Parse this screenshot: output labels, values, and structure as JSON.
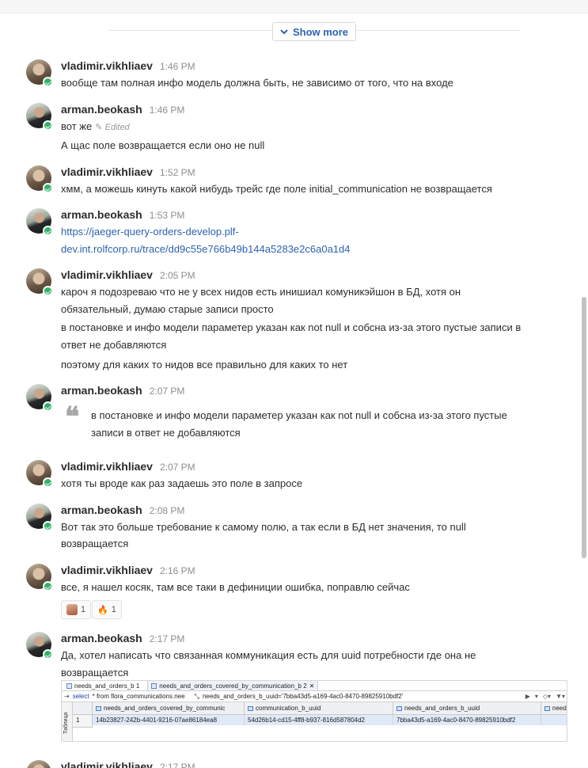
{
  "show_more": {
    "label": "Show more"
  },
  "messages": [
    {
      "author": "vladimir.vikhliaev",
      "time": "1:46 PM",
      "lines": [
        "вообще там полная инфо модель должна быть, не зависимо от того, что на входе"
      ]
    },
    {
      "author": "arman.beokash",
      "time": "1:46 PM",
      "lines": [
        "вот же",
        "А щас поле возвращается если оно не null"
      ],
      "edited": "Edited"
    },
    {
      "author": "vladimir.vikhliaev",
      "time": "1:52 PM",
      "lines": [
        "хмм, а можешь кинуть какой нибудь трейс где поле initial_communication не возвращается"
      ]
    },
    {
      "author": "arman.beokash",
      "time": "1:53 PM",
      "link_lines": [
        "https://jaeger-query-orders-develop.plf-",
        "dev.int.rolfcorp.ru/trace/dd9c55e766b49b144a5283e2c6a0a1d4"
      ]
    },
    {
      "author": "vladimir.vikhliaev",
      "time": "2:05 PM",
      "lines": [
        "кароч я подозреваю что не у всех нидов есть инишиал комуникэйшон в БД, хотя он",
        "обязательный, думаю старые записи просто",
        "в постановке и инфо модели параметер указан как not null и собсна из-за этого пустые записи в",
        "ответ не добавляются",
        "поэтому для каких то нидов все правильно для каких то нет"
      ]
    },
    {
      "author": "arman.beokash",
      "time": "2:07 PM",
      "quote_lines": [
        "в постановке и инфо модели параметер указан как not null и собсна из-за этого пустые",
        "записи в ответ не добавляются"
      ]
    },
    {
      "author": "vladimir.vikhliaev",
      "time": "2:07 PM",
      "lines": [
        "хотя ты вроде как раз задаешь это поле в запросе"
      ]
    },
    {
      "author": "arman.beokash",
      "time": "2:08 PM",
      "lines": [
        "Вот так это больше требование к самому полю, а так если в БД нет значения, то null",
        "возвращается"
      ]
    },
    {
      "author": "vladimir.vikhliaev",
      "time": "2:16 PM",
      "lines": [
        "все, я нашел косяк, там все таки в дефиниции ошибка, поправлю сейчас"
      ],
      "reactions": [
        {
          "emoji": "",
          "count": "1"
        },
        {
          "emoji": "🔥",
          "count": "1"
        }
      ]
    },
    {
      "author": "arman.beokash",
      "time": "2:17 PM",
      "lines": [
        "Да, хотел написать что связанная коммуникация есть для uuid потребности где она не",
        "возвращается"
      ]
    },
    {
      "author": "vladimir.vikhliaev",
      "time": "2:17 PM"
    }
  ],
  "screenshot": {
    "tabs": [
      "needs_and_orders_b 1",
      "needs_and_orders_covered_by_communication_b 2"
    ],
    "tab_close": "✕",
    "query_select": "select",
    "query_rest": "* from flora_communications.nee",
    "query_filter": "needs_and_orders_b_uuid='7bba43d5-a169-4ac0-8470-89825910bdf2'",
    "side_label": "Таблица",
    "columns": [
      "needs_and_orders_covered_by_communic",
      "communication_b_uuid",
      "needs_and_orders_b_uuid",
      "need"
    ],
    "row": [
      "1",
      "14b23827-242b-4401-9216-07ae86184ea8",
      "54d26b14-cd15-4ff8-b937-816d587804d2",
      "7bba43d5-a169-4ac0-8470-89825910bdf2"
    ]
  }
}
